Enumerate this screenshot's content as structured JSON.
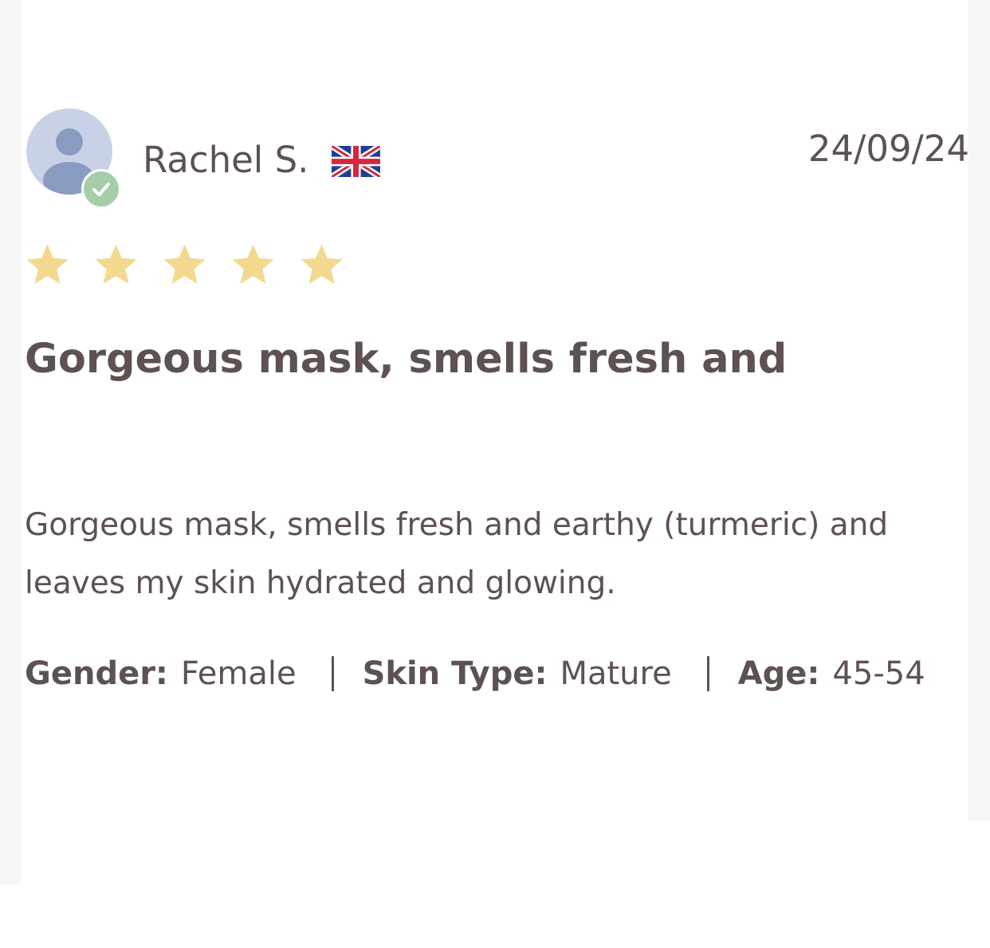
{
  "review": {
    "reviewer_name": "Rachel S.",
    "verified_icon": "check-icon",
    "country_flag_icon": "uk-flag-icon",
    "date": "24/09/24",
    "rating": 5,
    "rating_max": 5,
    "title": "Gorgeous mask, smells fresh and",
    "body": "Gorgeous mask, smells fresh and earthy (turmeric) and leaves my skin hydrated and glowing.",
    "attributes": [
      {
        "label": "Gender:",
        "value": "Female"
      },
      {
        "label": "Skin Type:",
        "value": "Mature"
      },
      {
        "label": "Age:",
        "value": "45-54"
      }
    ]
  },
  "colors": {
    "text": "#5e5151",
    "star": "#f2d98f",
    "avatar_bg": "#c9d1e6",
    "avatar_figure": "#8a9bc2",
    "verified_badge": "#a5cda7",
    "side_panel": "#f7f7f7"
  }
}
